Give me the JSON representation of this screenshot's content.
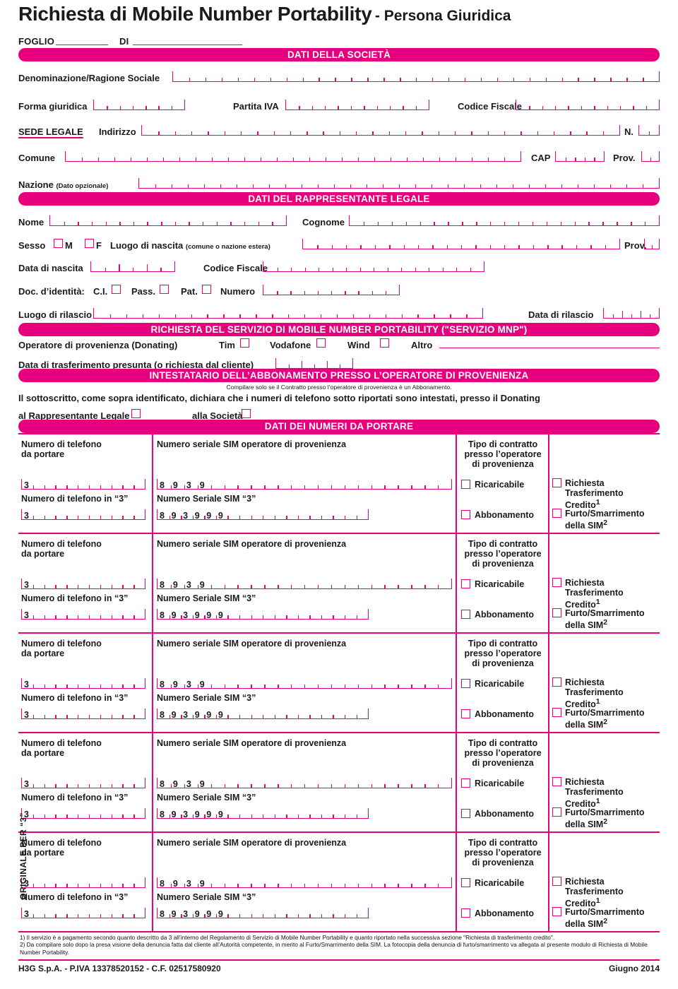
{
  "header": {
    "title_main": "Richiesta di Mobile Number Portability",
    "title_sub": "- Persona Giuridica",
    "foglio_label": "FOGLIO",
    "di_label": "DI"
  },
  "section_company": {
    "bar": "DATI DELLA SOCIETÀ",
    "denominazione_label": "Denominazione/Ragione Sociale",
    "forma_giuridica_label": "Forma giuridica",
    "partita_iva_label": "Partita IVA",
    "codice_fiscale_label": "Codice Fiscale",
    "sede_legale_label": "SEDE LEGALE",
    "indirizzo_label": "Indirizzo",
    "n_label": "N.",
    "comune_label": "Comune",
    "cap_label": "CAP",
    "prov_label": "Prov.",
    "nazione_label": "Nazione",
    "nazione_note": "(Dato opzionale)"
  },
  "section_rep": {
    "bar": "DATI DEL RAPPRESENTANTE LEGALE",
    "nome_label": "Nome",
    "cognome_label": "Cognome",
    "sesso_label": "Sesso",
    "sesso_m": "M",
    "sesso_f": "F",
    "luogo_nascita_label": "Luogo di nascita",
    "luogo_nascita_note": "(comune o nazione estera)",
    "prov_label": "Prov.",
    "data_nascita_label": "Data di nascita",
    "codice_fiscale_label": "Codice Fiscale",
    "doc_label": "Doc. d’identità:",
    "doc_ci": "C.I.",
    "doc_pass": "Pass.",
    "doc_pat": "Pat.",
    "doc_numero": "Numero",
    "luogo_rilascio_label": "Luogo di rilascio",
    "data_rilascio_label": "Data di rilascio"
  },
  "section_mnp": {
    "bar": "RICHIESTA DEL SERVIZIO DI MOBILE NUMBER PORTABILITY (\"SERVIZIO MNP\")",
    "operatore_label": "Operatore di provenienza (Donating)",
    "operators": [
      "Tim",
      "Vodafone",
      "Wind"
    ],
    "altro_label": "Altro",
    "data_trasferimento_label": "Data di trasferimento presunta (o richiesta dal cliente)"
  },
  "section_intestatario": {
    "bar": "INTESTATARIO DELL’ABBONAMENTO PRESSO L’OPERATORE DI PROVENIENZA",
    "note": "Compilare solo se il Contratto presso l’operatore di provenienza è un Abbonamento.",
    "declaration": "Il sottoscritto, come sopra identificato, dichiara che i numeri di telefono sotto riportati sono intestati, presso il Donating",
    "opt_rappresentante": "al Rappresentante Legale",
    "opt_societa": "alla Società"
  },
  "section_numbers": {
    "bar": "DATI DEI NUMERI DA PORTARE",
    "col1_header": "Numero di telefono\nda portare",
    "col1_header_l1": "Numero di telefono",
    "col1_header_l2": "da portare",
    "col2_header": "Numero seriale SIM operatore di provenienza",
    "col3_header_l1": "Tipo di contratto",
    "col3_header_l2": "presso l’operatore",
    "col3_header_l3": "di provenienza",
    "row_label_tel3": "Numero di telefono in “3”",
    "row_label_sim3": "Numero Seriale SIM “3”",
    "prefix_tel": "3",
    "prefix_sim_donating": "8939",
    "prefix_sim_3": "893999",
    "chk_ricaricabile": "Ricaricabile",
    "chk_abbonamento": "Abbonamento",
    "chk_richiesta_l1": "Richiesta Trasferimento",
    "chk_richiesta_l2": "Credito",
    "chk_richiesta_sup": "1",
    "chk_furto_l1": "Furto/Smarrimento",
    "chk_furto_l2": "della SIM",
    "chk_furto_sup": "2",
    "block_count": 5
  },
  "footnotes": {
    "note1": "1) Il servizio è a pagamento secondo quanto descritto da 3 all’interno del Regolamento di Servizio di Mobile Number Portability e quanto riportato nella successiva sezione \"Richiesta di trasferimento credito\".",
    "note2": "2) Da compilare solo dopo la presa visione della denuncia fatta dal cliente all’Autorità competente, in merito al Furto/Smarrimento della SIM. La fotocopia della denuncia di furto/smarrimento va allegata al presente modulo di Richiesta di Mobile Number Portability."
  },
  "footer": {
    "left": "H3G S.p.A. - P.IVA 13378520152 - C.F. 02517580920",
    "right": "Giugno 2014"
  },
  "sidebar": {
    "vertical_text": "ORIGINALE PER “3”"
  },
  "colors": {
    "magenta": "#E6007E",
    "text": "#1a1a1a"
  }
}
